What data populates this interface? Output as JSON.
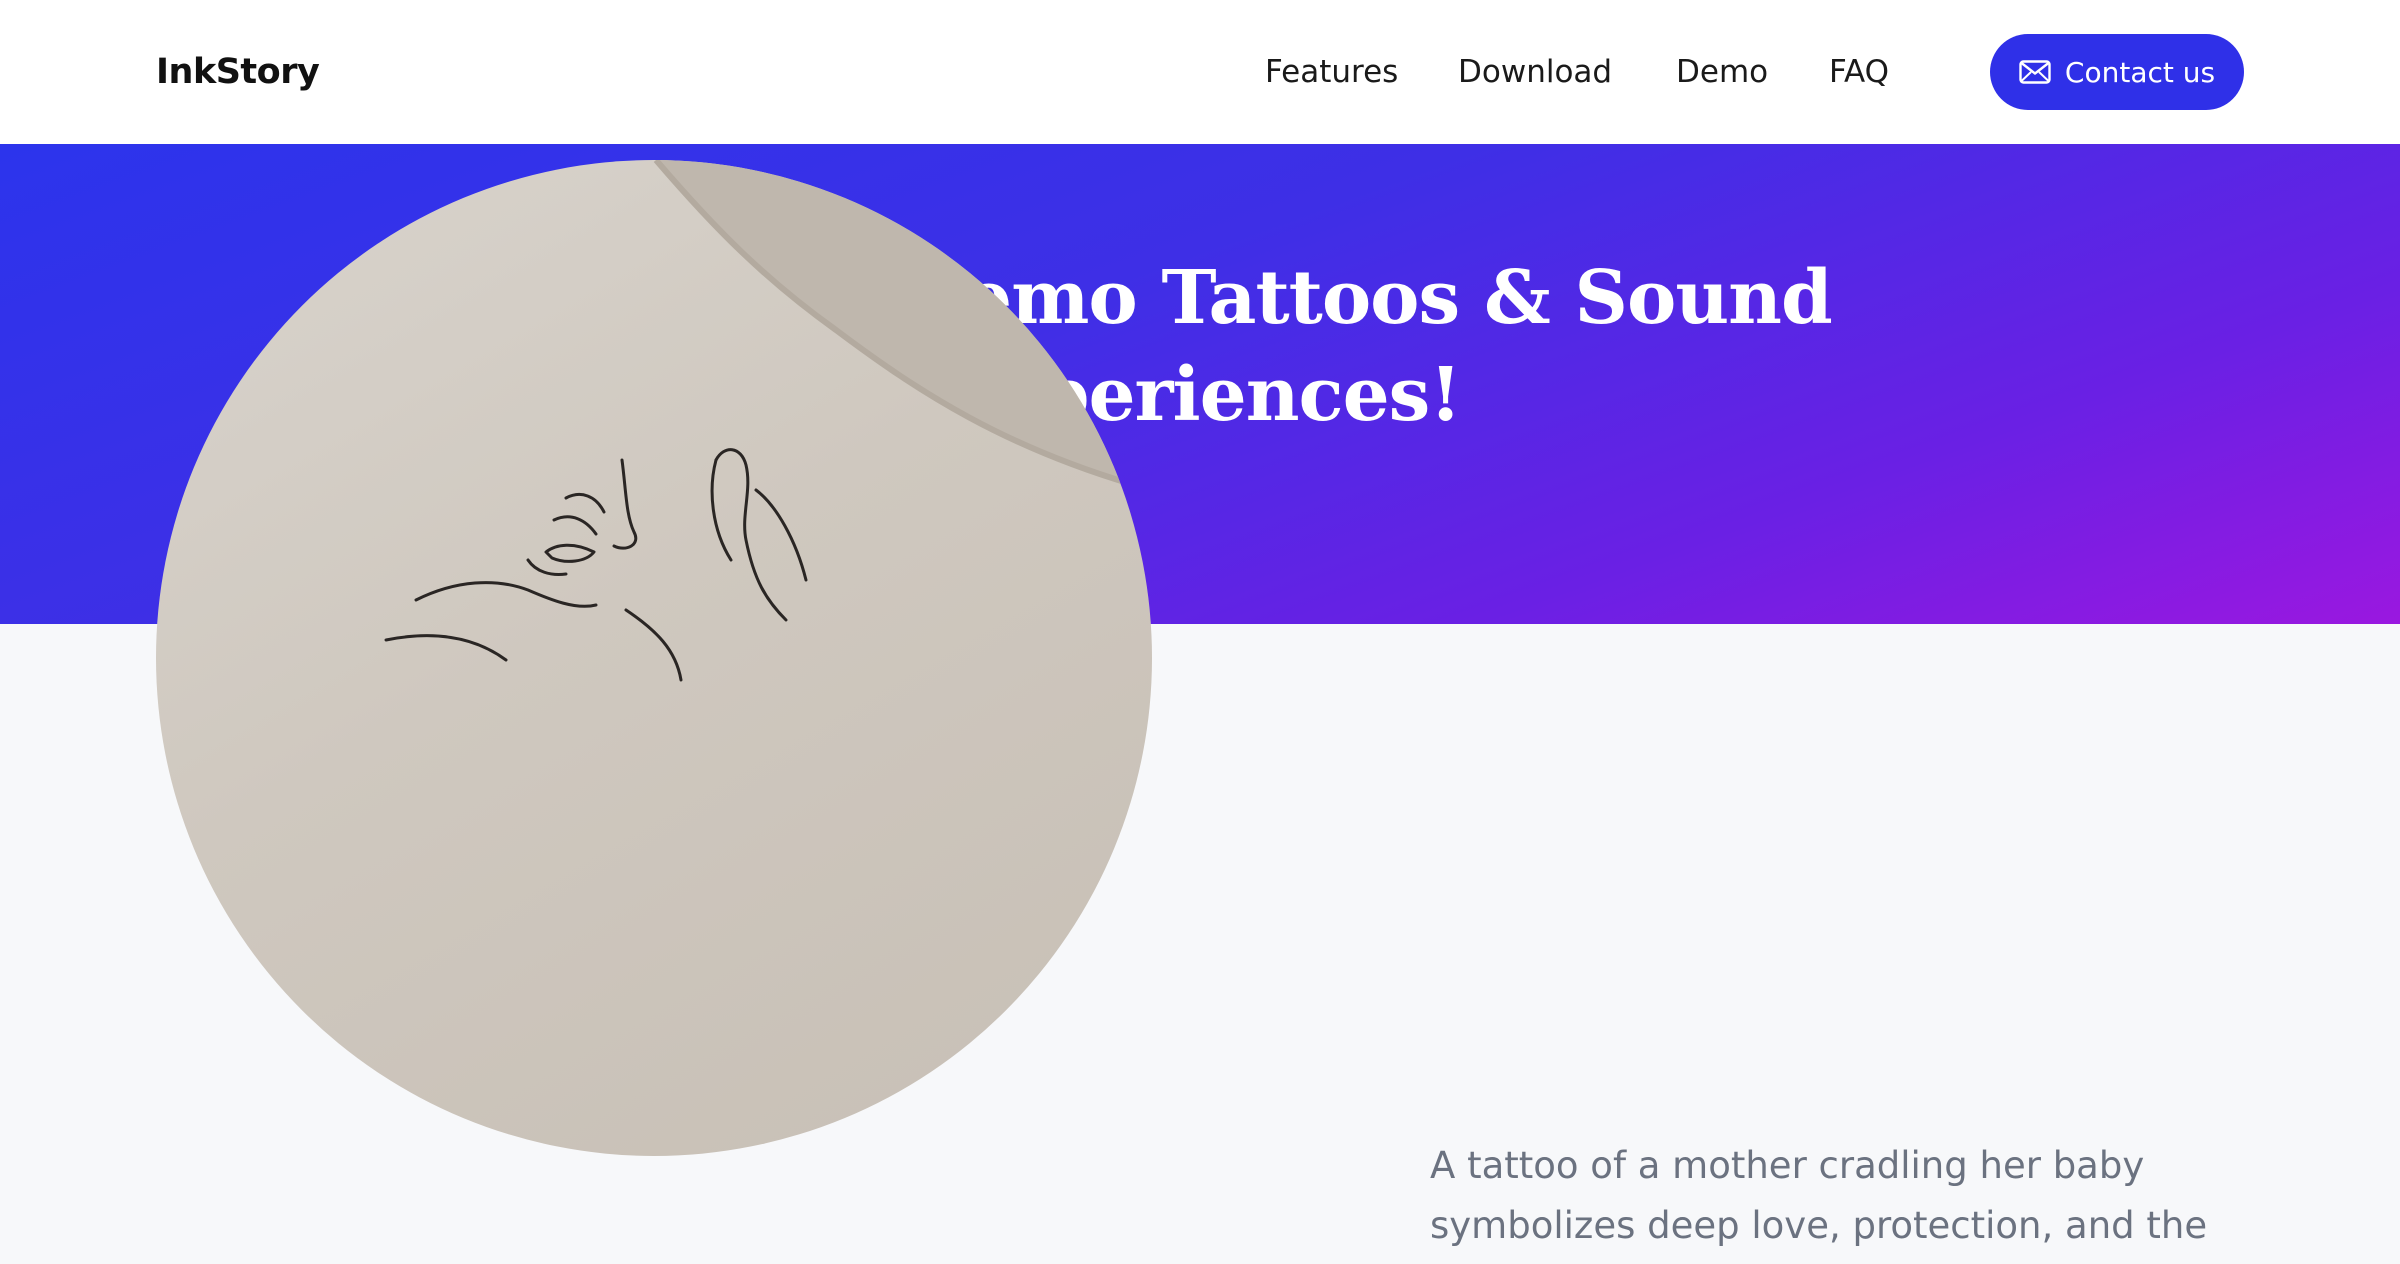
{
  "header": {
    "brand": "InkStory",
    "nav": [
      {
        "label": "Features"
      },
      {
        "label": "Download"
      },
      {
        "label": "Demo"
      },
      {
        "label": "FAQ"
      }
    ],
    "contact_label": "Contact us",
    "contact_icon": "mail-icon"
  },
  "hero": {
    "title": "Explore Demo Tattoos & Sound Experiences!"
  },
  "demo": {
    "image_alt": "Line-art tattoo of a mother cradling her baby",
    "description": "A tattoo of a mother cradling her baby symbolizes deep love, protection, and the"
  },
  "colors": {
    "accent": "#2f30e8",
    "hero_gradient_start": "#2c34ec",
    "hero_gradient_end": "#9a18e0",
    "page_background": "#f7f8fa",
    "body_text": "#6b7280"
  }
}
